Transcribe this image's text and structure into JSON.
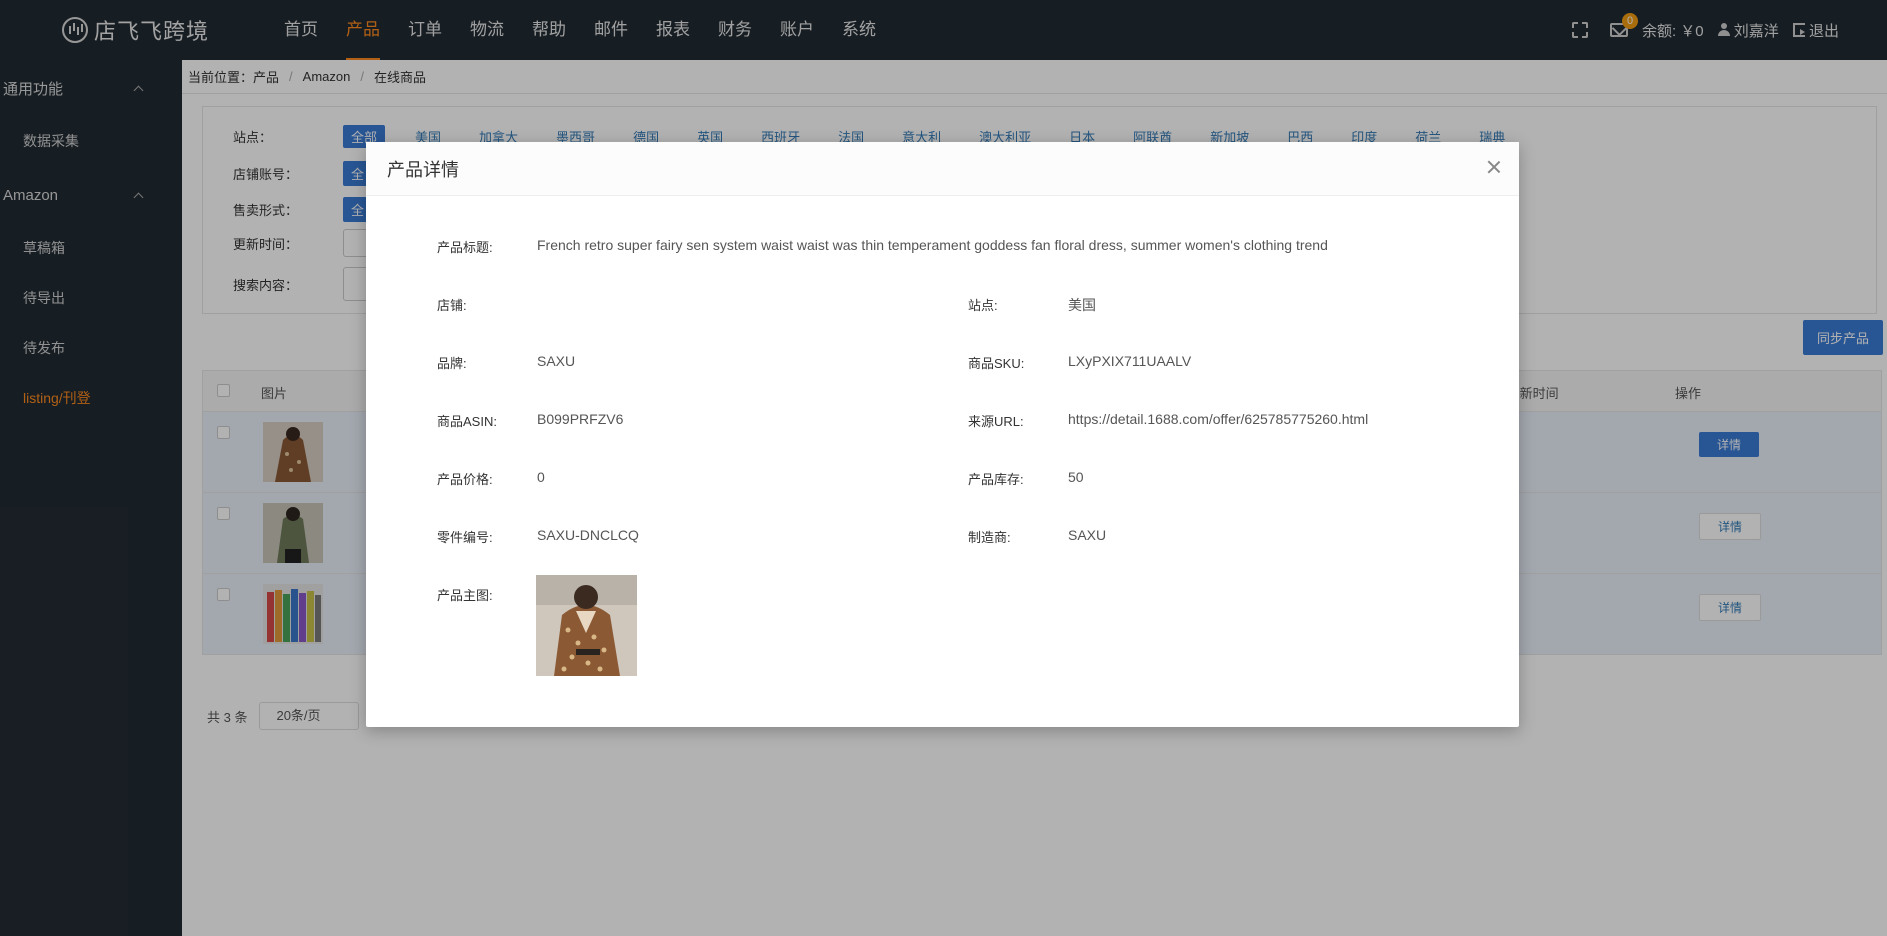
{
  "app": {
    "logo_text": "店飞飞跨境",
    "nav": [
      "首页",
      "产品",
      "订单",
      "物流",
      "帮助",
      "邮件",
      "报表",
      "财务",
      "账户",
      "系统"
    ],
    "active_nav": "产品",
    "mail_badge": "0",
    "balance": "余额: ￥0",
    "user_name": "刘嘉洋",
    "logout": "退出"
  },
  "sidebar": {
    "groups": [
      {
        "label": "通用功能",
        "items": [
          "数据采集"
        ]
      },
      {
        "label": "Amazon",
        "items": [
          "草稿箱",
          "待导出",
          "待发布",
          "listing/刊登"
        ]
      }
    ],
    "active_item": "listing/刊登"
  },
  "breadcrumb": {
    "prefix": "当前位置：",
    "items": [
      "产品",
      "Amazon",
      "在线商品"
    ]
  },
  "filters": {
    "site_label": "站点：",
    "sites": [
      "全部",
      "美国",
      "加拿大",
      "墨西哥",
      "德国",
      "英国",
      "西班牙",
      "法国",
      "意大利",
      "澳大利亚",
      "日本",
      "阿联酋",
      "新加坡",
      "巴西",
      "印度",
      "荷兰",
      "瑞典"
    ],
    "store_label": "店铺账号：",
    "sale_label": "售卖形式：",
    "all_short": "全",
    "update_label": "更新时间：",
    "search_label": "搜索内容："
  },
  "sync_button": "同步产品",
  "table": {
    "headers": {
      "image": "图片",
      "update_time": "/更新时间",
      "action": "操作"
    },
    "detail_label": "详情"
  },
  "pager": {
    "total": "共 3 条",
    "page_size": "20条/页"
  },
  "modal": {
    "title": "产品详情",
    "title_label": "产品标题:",
    "title_value": "French retro super fairy sen system waist waist was thin temperament goddess fan floral dress, summer women's clothing trend",
    "store_label": "店铺:",
    "store_value": "",
    "site_label": "站点:",
    "site_value": "美国",
    "brand_label": "品牌:",
    "brand_value": "SAXU",
    "sku_label": "商品SKU:",
    "sku_value": "LXyPXIX711UAALV",
    "asin_label": "商品ASIN:",
    "asin_value": "B099PRFZV6",
    "url_label": "来源URL:",
    "url_value": "https://detail.1688.com/offer/625785775260.html",
    "price_label": "产品价格:",
    "price_value": "0",
    "stock_label": "产品库存:",
    "stock_value": "50",
    "part_label": "零件编号:",
    "part_value": "SAXU-DNCLCQ",
    "maker_label": "制造商:",
    "maker_value": "SAXU",
    "image_label": "产品主图:"
  }
}
